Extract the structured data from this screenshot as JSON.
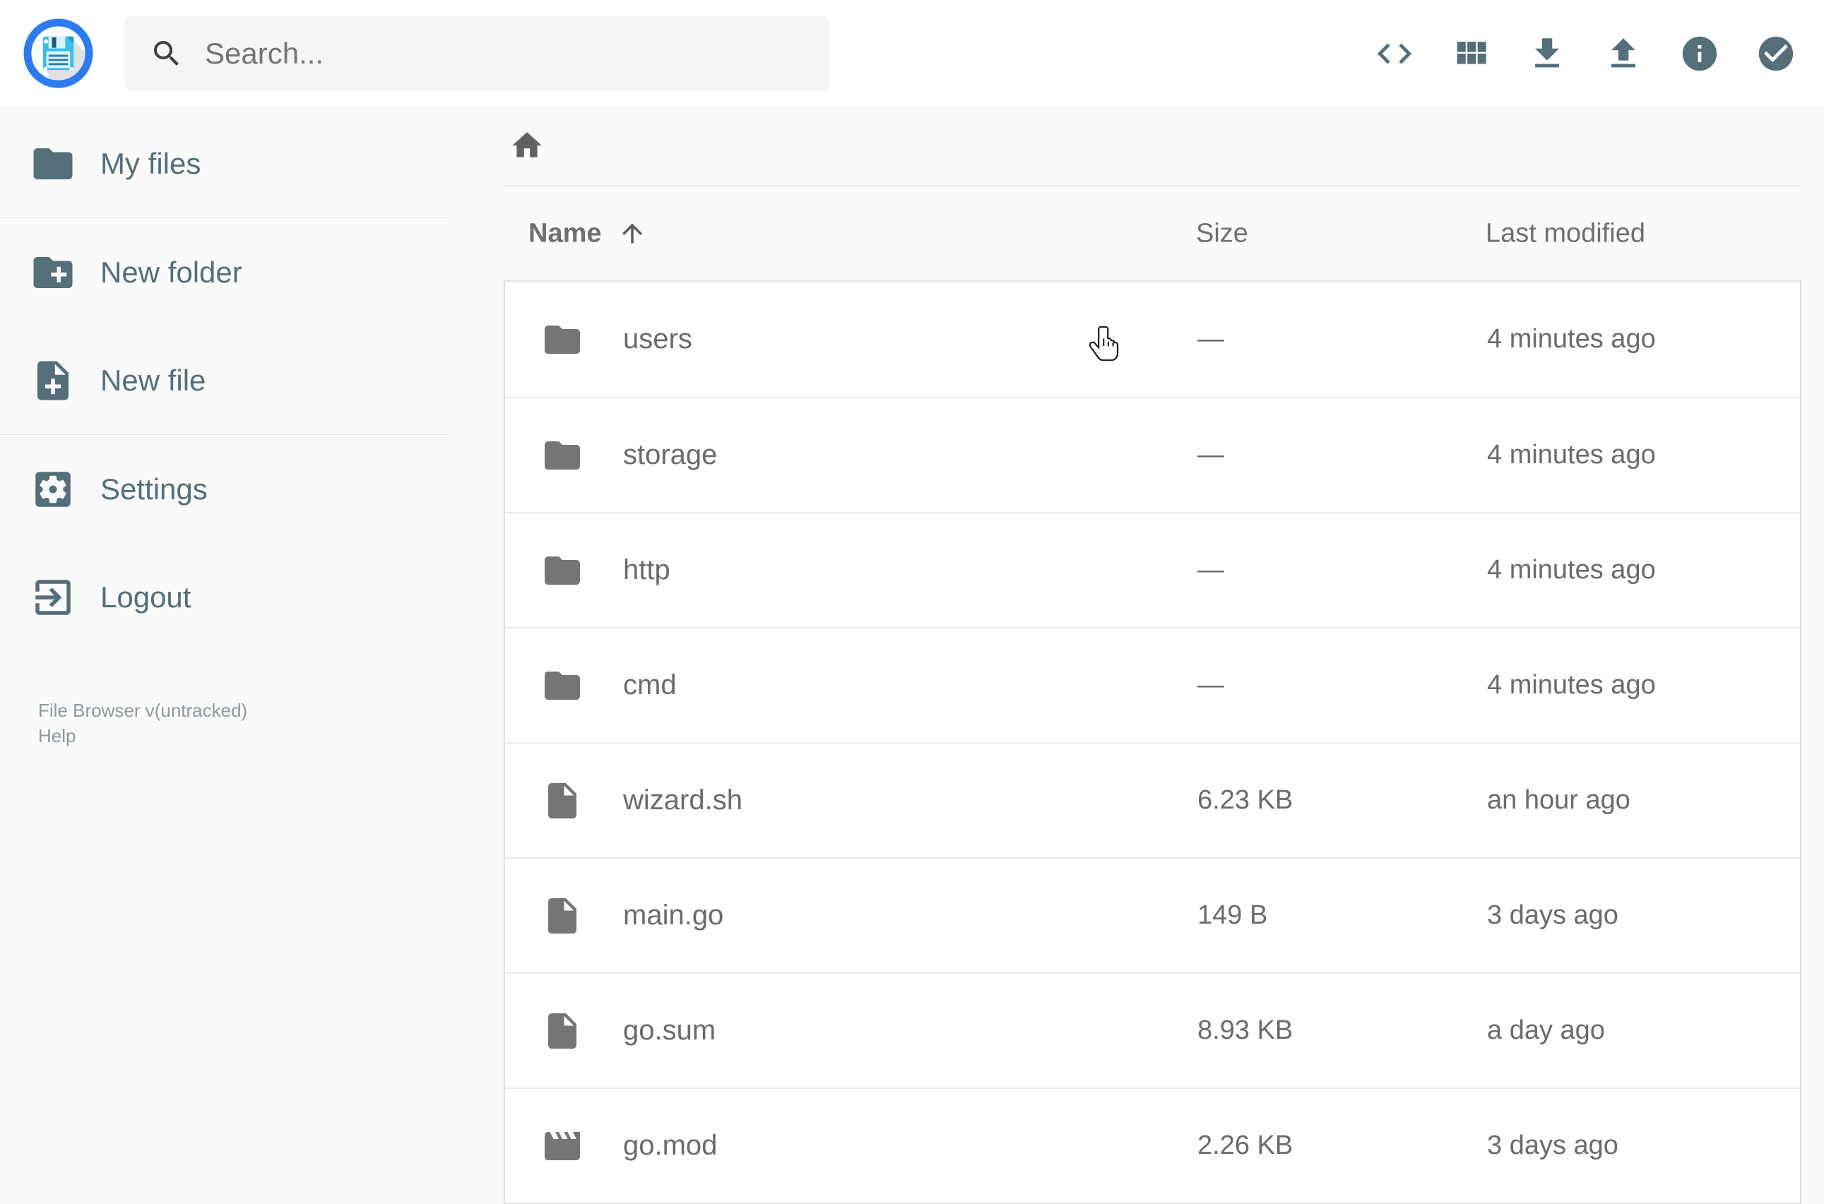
{
  "header": {
    "search": {
      "placeholder": "Search..."
    },
    "actions": {
      "code_view": "code-view",
      "view_mode": "switch-view",
      "download": "download",
      "upload": "upload",
      "info": "info",
      "select": "select-multiple"
    }
  },
  "sidebar": {
    "items": [
      {
        "label": "My files",
        "icon": "folder-icon"
      },
      {
        "label": "New folder",
        "icon": "create-new-folder-icon"
      },
      {
        "label": "New file",
        "icon": "note-add-icon"
      },
      {
        "label": "Settings",
        "icon": "settings-icon"
      },
      {
        "label": "Logout",
        "icon": "logout-icon"
      }
    ],
    "footer": {
      "version": "File Browser v(untracked)",
      "help": "Help"
    }
  },
  "listing": {
    "columns": {
      "name": "Name",
      "size": "Size",
      "modified": "Last modified"
    },
    "sort": {
      "by": "name",
      "direction": "asc"
    },
    "rows": [
      {
        "name": "users",
        "type": "folder",
        "size": "—",
        "modified": "4 minutes ago"
      },
      {
        "name": "storage",
        "type": "folder",
        "size": "—",
        "modified": "4 minutes ago"
      },
      {
        "name": "http",
        "type": "folder",
        "size": "—",
        "modified": "4 minutes ago"
      },
      {
        "name": "cmd",
        "type": "folder",
        "size": "—",
        "modified": "4 minutes ago"
      },
      {
        "name": "wizard.sh",
        "type": "file",
        "size": "6.23 KB",
        "modified": "an hour ago"
      },
      {
        "name": "main.go",
        "type": "file",
        "size": "149 B",
        "modified": "3 days ago"
      },
      {
        "name": "go.sum",
        "type": "file",
        "size": "8.93 KB",
        "modified": "a day ago"
      },
      {
        "name": "go.mod",
        "type": "movie",
        "size": "2.26 KB",
        "modified": "3 days ago"
      }
    ]
  },
  "colors": {
    "accent_ring": "#2b7bf3",
    "logo_blue": "#39bef2",
    "sidebar_slate": "#546e7a",
    "list_gray": "#6b6b6b",
    "background": "#fafafa"
  }
}
